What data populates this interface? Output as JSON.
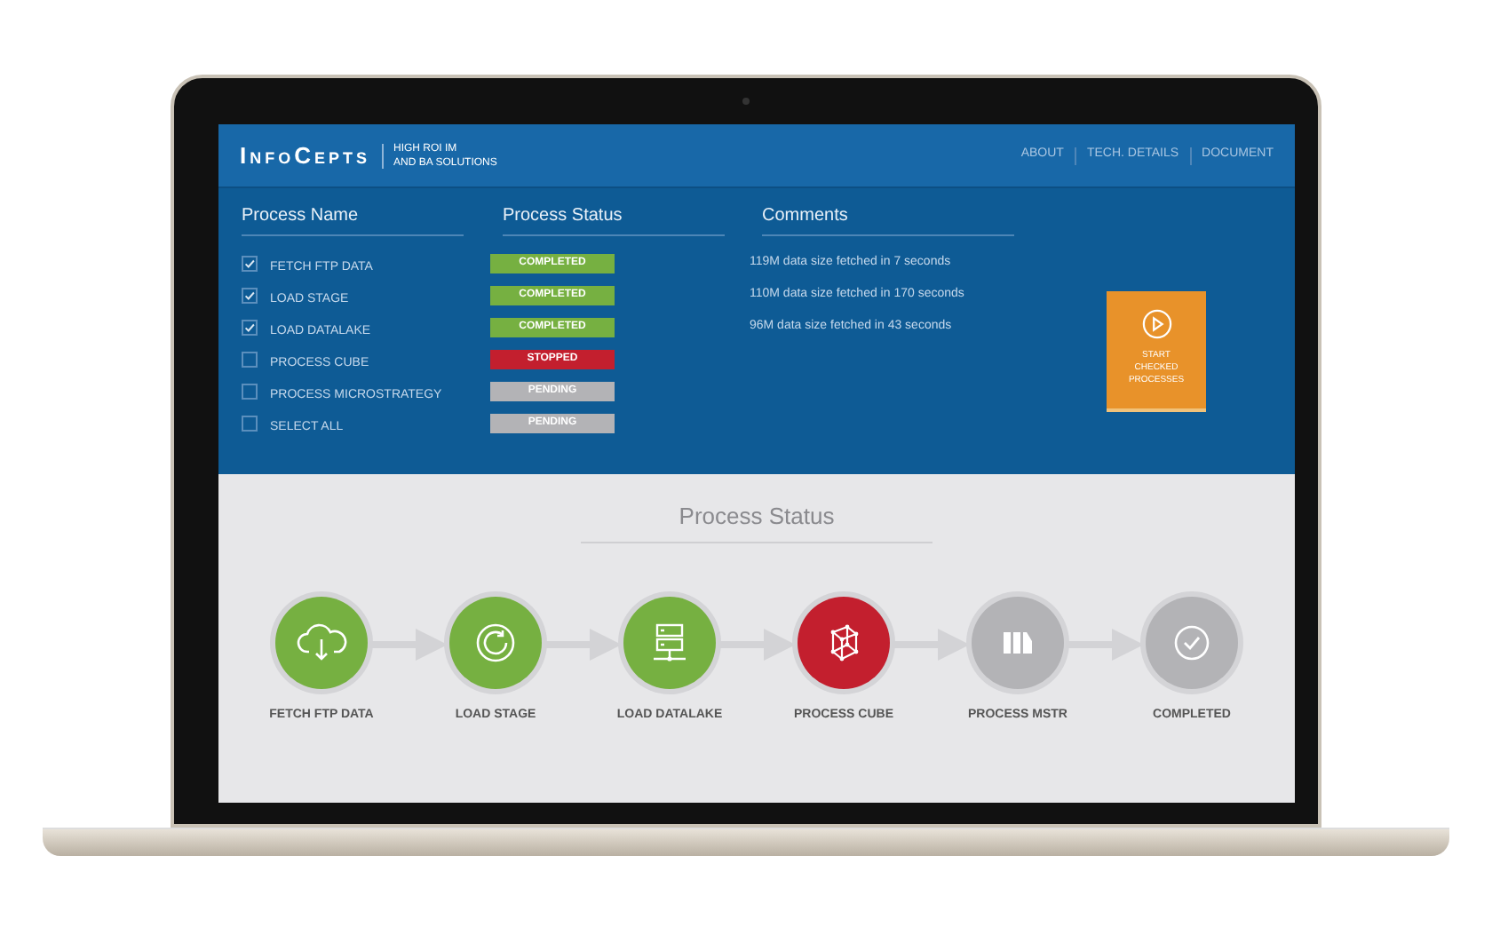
{
  "header": {
    "logo": "InfoCepts",
    "tagline_line_1": "HIGH ROI IM",
    "tagline_line_2": "AND BA SOLUTIONS",
    "nav": [
      "ABOUT",
      "TECH. DETAILS",
      "DOCUMENT"
    ]
  },
  "columns": [
    "Process Name",
    "Process Status",
    "Comments"
  ],
  "processes": [
    {
      "name": "FETCH FTP DATA",
      "checked": true,
      "color": "#76b041",
      "status_label": "COMPLETED",
      "comment": "119M data size fetched in 7 seconds"
    },
    {
      "name": "LOAD STAGE",
      "checked": true,
      "color": "#76b041",
      "status_label": "COMPLETED",
      "comment": "110M data size fetched in 170 seconds"
    },
    {
      "name": "LOAD DATALAKE",
      "checked": true,
      "color": "#76b041",
      "status_label": "COMPLETED",
      "comment": "96M data size fetched in 43 seconds"
    },
    {
      "name": "PROCESS CUBE",
      "checked": false,
      "color": "#c31f2e",
      "status_label": "STOPPED"
    },
    {
      "name": "PROCESS MICROSTRATEGY",
      "checked": false,
      "color": "#b3b3b6",
      "status_label": "PENDING"
    },
    {
      "name": "SELECT ALL",
      "checked": false,
      "color": "#b3b3b6",
      "status_label": "PENDING"
    }
  ],
  "start_button": {
    "line_1": "START",
    "line_2": "CHECKED",
    "line_3": "PROCESSES"
  },
  "pipeline": {
    "title": "Process Status",
    "steps": [
      {
        "label": "FETCH FTP DATA",
        "color": "#76b041"
      },
      {
        "label": "LOAD STAGE",
        "color": "#76b041"
      },
      {
        "label": "LOAD DATALAKE",
        "color": "#76b041"
      },
      {
        "label": "PROCESS CUBE",
        "color": "#c31f2e"
      },
      {
        "label": "PROCESS MSTR",
        "color": "#b3b3b6"
      },
      {
        "label": "COMPLETED",
        "color": "#b3b3b6"
      }
    ]
  }
}
